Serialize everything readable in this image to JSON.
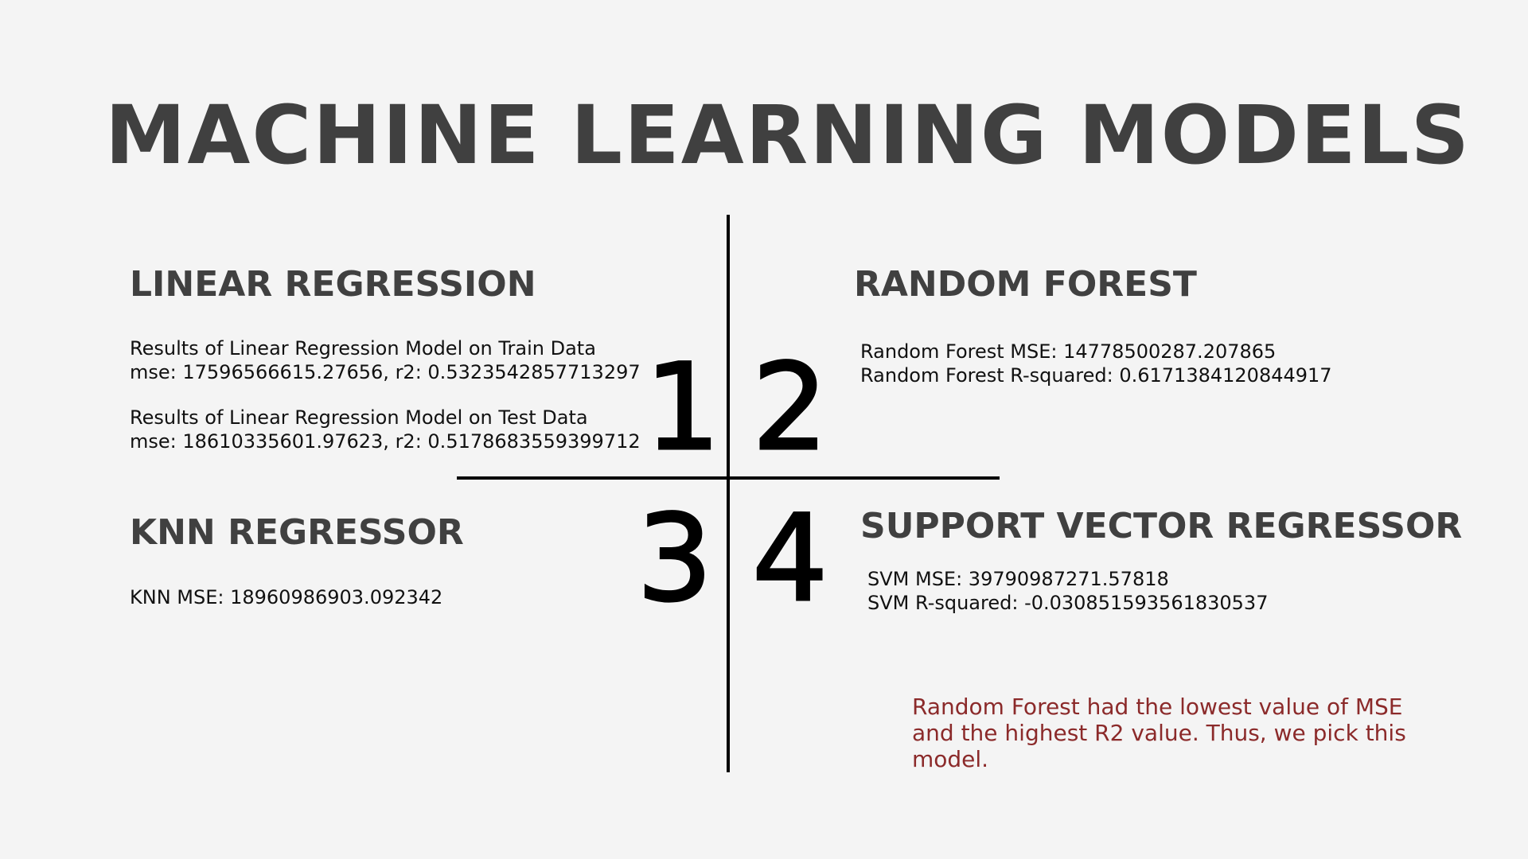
{
  "title": "MACHINE LEARNING MODELS",
  "colors": {
    "background": "#f4f4f4",
    "heading": "#404040",
    "body": "#111111",
    "conclusion": "#8b2a2a",
    "divider": "#000000"
  },
  "quadrants": {
    "linear_regression": {
      "number": "1",
      "heading": "LINEAR REGRESSION",
      "train_label": "Results of Linear Regression Model on Train Data",
      "train_metrics": "mse: 17596566615.27656, r2: 0.5323542857713297",
      "test_label": "Results of Linear Regression Model on Test Data",
      "test_metrics": "mse: 18610335601.97623, r2: 0.5178683559399712"
    },
    "random_forest": {
      "number": "2",
      "heading": "RANDOM FOREST",
      "mse": "Random Forest MSE: 14778500287.207865",
      "r2": "Random Forest R-squared: 0.6171384120844917"
    },
    "knn": {
      "number": "3",
      "heading": "KNN REGRESSOR",
      "mse": "KNN MSE: 18960986903.092342"
    },
    "svr": {
      "number": "4",
      "heading": "SUPPORT VECTOR REGRESSOR",
      "mse": "SVM MSE: 39790987271.57818",
      "r2": "SVM R-squared: -0.030851593561830537"
    }
  },
  "conclusion": "Random Forest had the lowest value of MSE and the highest R2 value. Thus, we pick this model."
}
